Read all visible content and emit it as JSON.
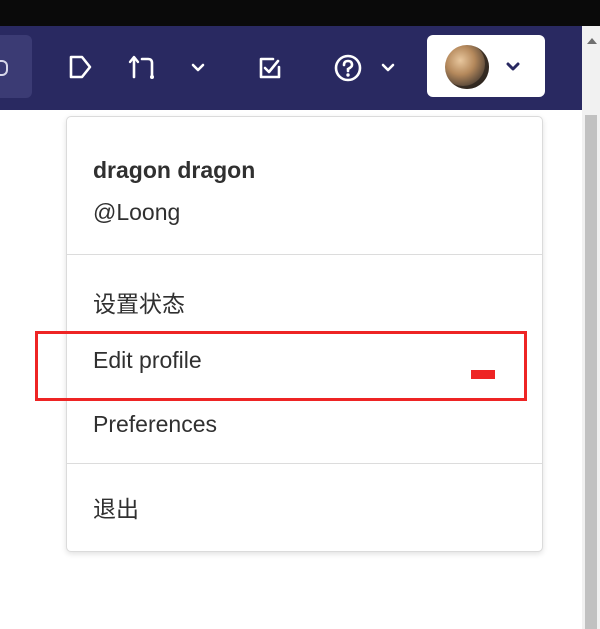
{
  "navbar": {
    "background_color": "#292961",
    "icons": [
      {
        "name": "search-icon"
      },
      {
        "name": "issues-icon"
      },
      {
        "name": "merge-requests-icon"
      },
      {
        "name": "todos-icon"
      },
      {
        "name": "help-icon"
      }
    ]
  },
  "user_menu": {
    "name": "dragon dragon",
    "username": "@Loong",
    "items": [
      {
        "label": "设置状态"
      },
      {
        "label": "Edit profile"
      },
      {
        "label": "Preferences"
      },
      {
        "label": "退出"
      }
    ]
  },
  "annotation": {
    "highlight_color": "#ee2424",
    "highlighted_item": "Edit profile"
  }
}
